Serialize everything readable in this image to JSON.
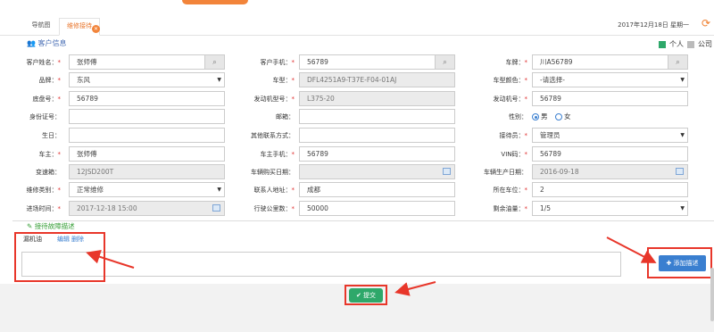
{
  "tabs": {
    "nav": "导航图",
    "active": "维修接待"
  },
  "date": "2017年12月18日  星期一",
  "section": {
    "title": "客户信息"
  },
  "legend": {
    "personal": "个人",
    "company": "公司",
    "personal_color": "#2ea86a",
    "company_color": "#bbbbbb"
  },
  "form": {
    "customer_name_label": "客户姓名：",
    "customer_name": "张师傅",
    "customer_phone_label": "客户手机：",
    "customer_phone": "56789",
    "plate_label": "车牌：",
    "plate": "川A56789",
    "brand_label": "品牌：",
    "brand": "东风",
    "model_label": "车型：",
    "model": "DFL4251A9-T37E-F04-01AJ",
    "color_label": "车型颜色：",
    "color": "-请选择-",
    "vin_short_label": "底盘号：",
    "vin_short": "56789",
    "engine_model_label": "发动机型号：",
    "engine_model": "L375-20",
    "engine_no_label": "发动机号：",
    "engine_no": "56789",
    "id_label": "身份证号：",
    "id_value": "",
    "email_label": "邮箱：",
    "email": "",
    "gender_label": "性别：",
    "gender_male": "男",
    "gender_female": "女",
    "birthday_label": "生日：",
    "birthday": "",
    "other_contact_label": "其他联系方式：",
    "other_contact": "",
    "receptionist_label": "接待员：",
    "receptionist": "管理员",
    "driver_label": "车主：",
    "driver": "张师傅",
    "driver_phone_label": "车主手机：",
    "driver_phone": "56789",
    "vin_label": "VIN码：",
    "vin": "56789",
    "gearbox_label": "变速箱：",
    "gearbox": "12JSD200T",
    "purchase_date_label": "车辆购买日期：",
    "purchase_date": "",
    "production_date_label": "车辆生产日期：",
    "production_date": "2016-09-18",
    "repair_type_label": "维修类别：",
    "repair_type": "正常维修",
    "address_label": "联系人地址：",
    "address": "成都",
    "station_label": "所在车位：",
    "station": "2",
    "arrival_label": "进场时间：",
    "arrival": "2017-12-18 15:00",
    "mileage_label": "行驶公里数：",
    "mileage": "50000",
    "fuel_label": "剩余油量：",
    "fuel": "1/5"
  },
  "description": {
    "header": "接待故障描述",
    "title": "漏机油",
    "edit": "编辑",
    "delete": "删除",
    "add_button": "添加描述"
  },
  "submit_label": "提交"
}
